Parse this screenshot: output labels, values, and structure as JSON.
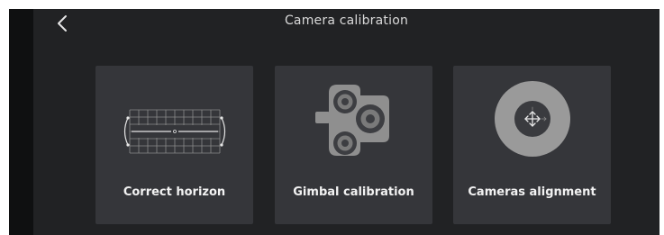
{
  "header": {
    "title": "Camera calibration",
    "back_icon": "chevron-left-icon"
  },
  "cards": [
    {
      "label": "Correct horizon",
      "icon": "horizon-grid-icon"
    },
    {
      "label": "Gimbal calibration",
      "icon": "gimbal-icon"
    },
    {
      "label": "Cameras alignment",
      "icon": "alignment-target-icon"
    }
  ],
  "colors": {
    "background": "#212224",
    "card": "#35363a",
    "text": "#f2f2f2",
    "icon": "#9a9a9a"
  }
}
